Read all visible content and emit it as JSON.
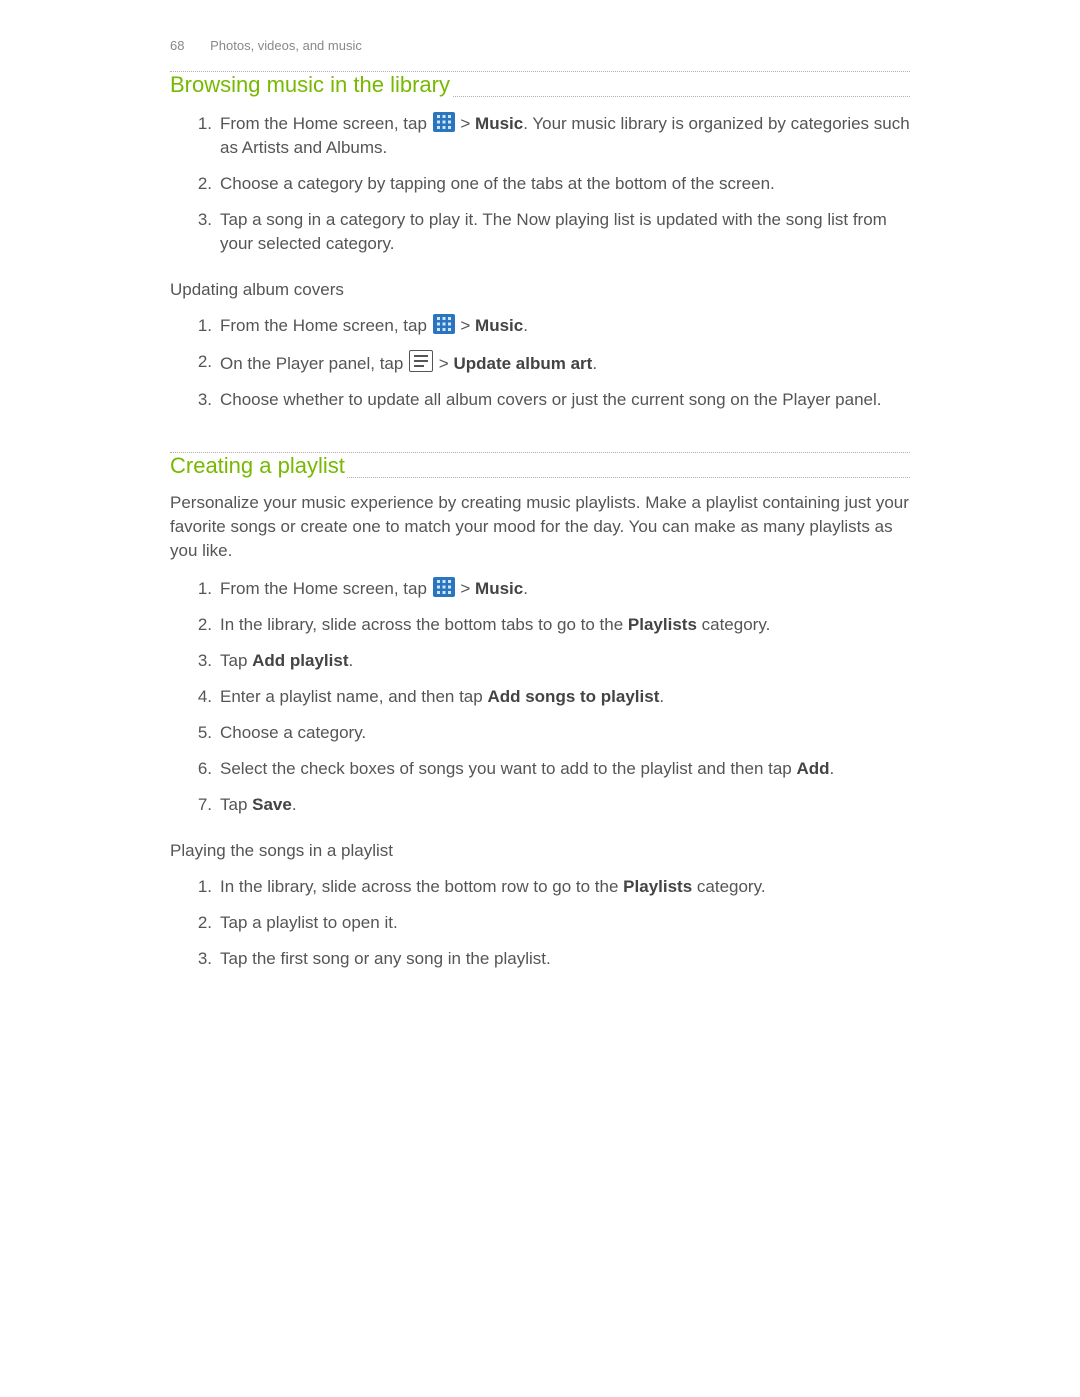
{
  "header": {
    "page_number": "68",
    "chapter": "Photos, videos, and music"
  },
  "section1": {
    "title": "Browsing music in the library",
    "steps": [
      {
        "num": "1.",
        "pre": "From the Home screen, tap ",
        "bold1": "Music",
        "tail": ". Your music library is organized by categories such as Artists and Albums."
      },
      {
        "num": "2.",
        "text": "Choose a category by tapping one of the tabs at the bottom of the screen."
      },
      {
        "num": "3.",
        "text": "Tap a song in a category to play it. The Now playing list is updated with the song list from your selected category."
      }
    ],
    "sub_heading": "Updating album covers",
    "sub_steps": [
      {
        "num": "1.",
        "pre": "From the Home screen, tap ",
        "bold1": "Music",
        "tail": "."
      },
      {
        "num": "2.",
        "pre": "On the Player panel, tap ",
        "bold1": "Update album art",
        "tail": "."
      },
      {
        "num": "3.",
        "text": "Choose whether to update all album covers or just the current song on the Player panel."
      }
    ]
  },
  "section2": {
    "title": "Creating a playlist",
    "intro": "Personalize your music experience by creating music playlists. Make a playlist containing just your favorite songs or create one to match your mood for the day. You can make as many playlists as you like.",
    "steps": [
      {
        "num": "1.",
        "pre": "From the Home screen, tap ",
        "bold1": "Music",
        "tail": "."
      },
      {
        "num": "2.",
        "pre": "In the library, slide across the bottom tabs to go to the ",
        "bold1": "Playlists",
        "tail": " category."
      },
      {
        "num": "3.",
        "pre": "Tap ",
        "bold1": "Add playlist",
        "tail": "."
      },
      {
        "num": "4.",
        "pre": "Enter a playlist name, and then tap ",
        "bold1": "Add songs to playlist",
        "tail": "."
      },
      {
        "num": "5.",
        "text": "Choose a category."
      },
      {
        "num": "6.",
        "pre": "Select the check boxes of songs you want to add to the playlist and then tap ",
        "bold1": "Add",
        "tail": "."
      },
      {
        "num": "7.",
        "pre": "Tap ",
        "bold1": "Save",
        "tail": "."
      }
    ],
    "sub_heading": "Playing the songs in a playlist",
    "sub_steps": [
      {
        "num": "1.",
        "pre": "In the library, slide across the bottom row to go to the ",
        "bold1": "Playlists",
        "tail": " category."
      },
      {
        "num": "2.",
        "text": "Tap a playlist to open it."
      },
      {
        "num": "3.",
        "text": "Tap the first song or any song in the playlist."
      }
    ]
  },
  "gt": " > "
}
